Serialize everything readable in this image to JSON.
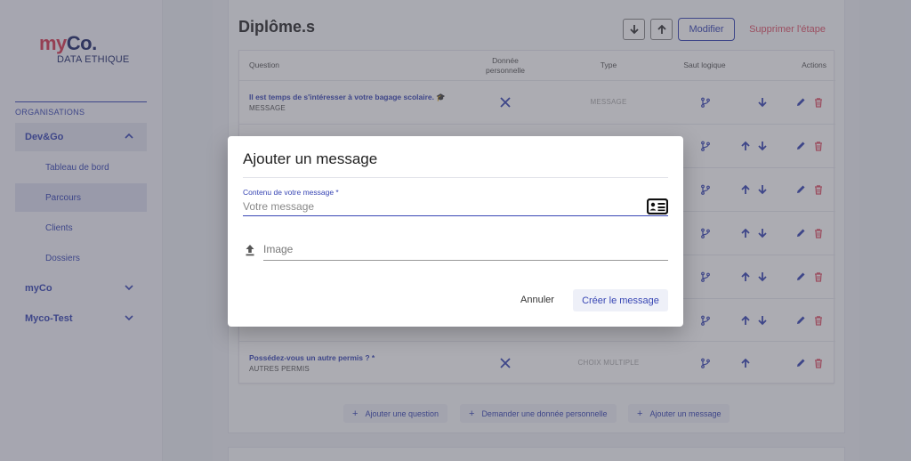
{
  "logo": {
    "my": "my",
    "co": "Co.",
    "sub": "DATA ETHIQUE"
  },
  "sidebar": {
    "section_label": "ORGANISATIONS",
    "items": [
      {
        "label": "Dev&Go"
      },
      {
        "label": "Tableau de bord"
      },
      {
        "label": "Parcours"
      },
      {
        "label": "Clients"
      },
      {
        "label": "Dossiers"
      },
      {
        "label": "myCo"
      },
      {
        "label": "Myco-Test"
      }
    ]
  },
  "step": {
    "title": "Diplôme.s",
    "modify_label": "Modifier",
    "delete_label": "Supprimer l'étape"
  },
  "table": {
    "headers": {
      "question": "Question",
      "personal_data": "Donnée personnelle",
      "type": "Type",
      "logic_jump": "Saut logique",
      "actions": "Actions"
    },
    "rows": [
      {
        "question": "Il est temps de s'intéresser à votre bagage scolaire. 🎓",
        "sub": "MESSAGE",
        "type": "MESSAGE"
      },
      {
        "question": "Possédez-vous un autre permis ? *",
        "sub": "AUTRES PERMIS",
        "type": "CHOIX MULTIPLE"
      }
    ]
  },
  "add_buttons": {
    "plus": "+",
    "question": "Ajouter une question",
    "personal_data": "Demander une donnée personnelle",
    "message": "Ajouter un message"
  },
  "modal": {
    "title": "Ajouter un message",
    "content_label": "Contenu de votre message *",
    "content_placeholder": "Votre message",
    "image_label": "Image",
    "cancel_label": "Annuler",
    "create_label": "Créer le message"
  },
  "colors": {
    "primary": "#3846b4",
    "danger": "#e0556a",
    "brand_red": "#d63a52"
  }
}
